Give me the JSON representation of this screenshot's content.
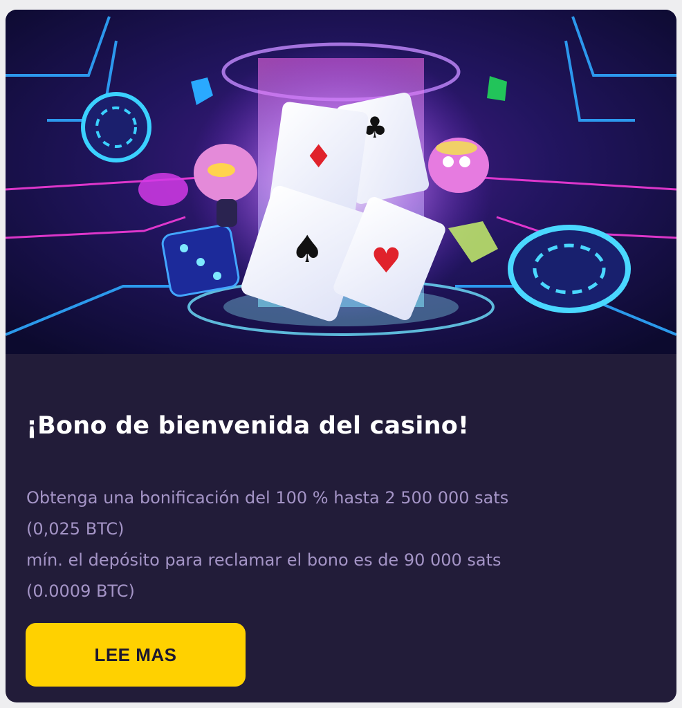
{
  "promo": {
    "title": "¡Bono de bienvenida del casino!",
    "description_lines": [
      "Obtenga una bonificación del 100 % hasta 2 500 000 sats",
      "(0,025 BTC)",
      "mín. el depósito para reclamar el bono es de 90 000 sats",
      "(0.0009 BTC)"
    ],
    "cta_label": "LEE MAS"
  },
  "colors": {
    "card_background": "#221c39",
    "title": "#ffffff",
    "description": "#a494c6",
    "button": "#ffd100",
    "button_text": "#1c1730"
  },
  "icons": [
    "playing-card-icon",
    "poker-chip-icon",
    "dice-icon",
    "gem-icon",
    "pig-mascot-icon"
  ]
}
